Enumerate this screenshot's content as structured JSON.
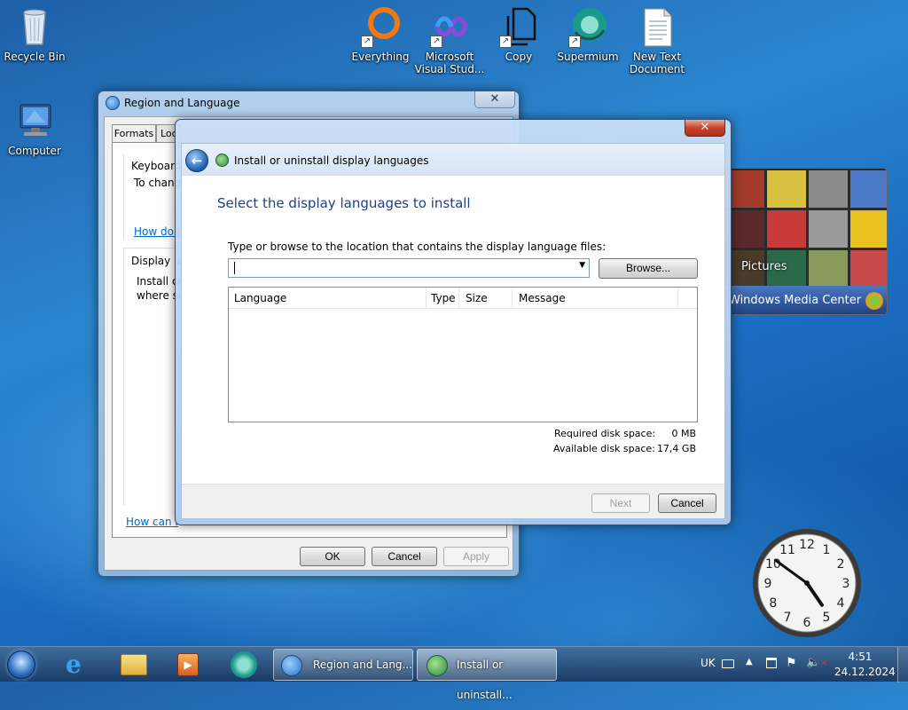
{
  "desktop_icons": [
    {
      "label": "Recycle Bin",
      "icon": "recycle-bin-icon"
    },
    {
      "label": "Computer",
      "icon": "computer-icon"
    },
    {
      "label": "Everything",
      "icon": "everything-icon"
    },
    {
      "label": "Microsoft Visual Stud...",
      "icon": "visual-studio-icon"
    },
    {
      "label": "Copy",
      "icon": "copy-icon"
    },
    {
      "label": "Supermium",
      "icon": "supermium-icon"
    },
    {
      "label": "New Text Document",
      "icon": "text-document-icon"
    }
  ],
  "region_window": {
    "title": "Region and Language",
    "tabs": [
      "Formats",
      "Loc"
    ],
    "keyboard_heading": "Keyboards",
    "keyboard_text": "To chang",
    "keyboard_link": "How do I",
    "display_heading": "Display la",
    "display_text_1": "Install or",
    "display_text_2": "where su",
    "bottom_link": "How can I",
    "ok": "OK",
    "cancel": "Cancel",
    "apply": "Apply"
  },
  "install_dialog": {
    "breadcrumb": "Install or uninstall display languages",
    "heading": "Select the display languages to install",
    "location_label": "Type or browse to the location that contains the display language files:",
    "location_value": "",
    "browse": "Browse...",
    "columns": [
      "Language",
      "Type",
      "Size",
      "Message"
    ],
    "rows": [],
    "required_label": "Required disk space:",
    "required_value": "0 MB",
    "available_label": "Available disk space:",
    "available_value": "17,4 GB",
    "next": "Next",
    "cancel": "Cancel"
  },
  "media_center": {
    "label": "Pictures",
    "title": "Windows Media Center"
  },
  "clock": {
    "numbers": [
      "12",
      "1",
      "2",
      "3",
      "4",
      "5",
      "6",
      "7",
      "8",
      "9",
      "10",
      "11"
    ],
    "hour": 4,
    "minute": 51
  },
  "taskbar": {
    "items": [
      {
        "label": "Region and Lang...",
        "icon": "region-language-icon"
      },
      {
        "label": "Install or uninstall...",
        "icon": "install-language-icon"
      }
    ],
    "language": "UK",
    "time": "4:51",
    "date": "24.12.2024"
  },
  "colors": {
    "heading_blue": "#1e3f8a",
    "link_blue": "#0066cc",
    "close_red": "#c7442f"
  }
}
